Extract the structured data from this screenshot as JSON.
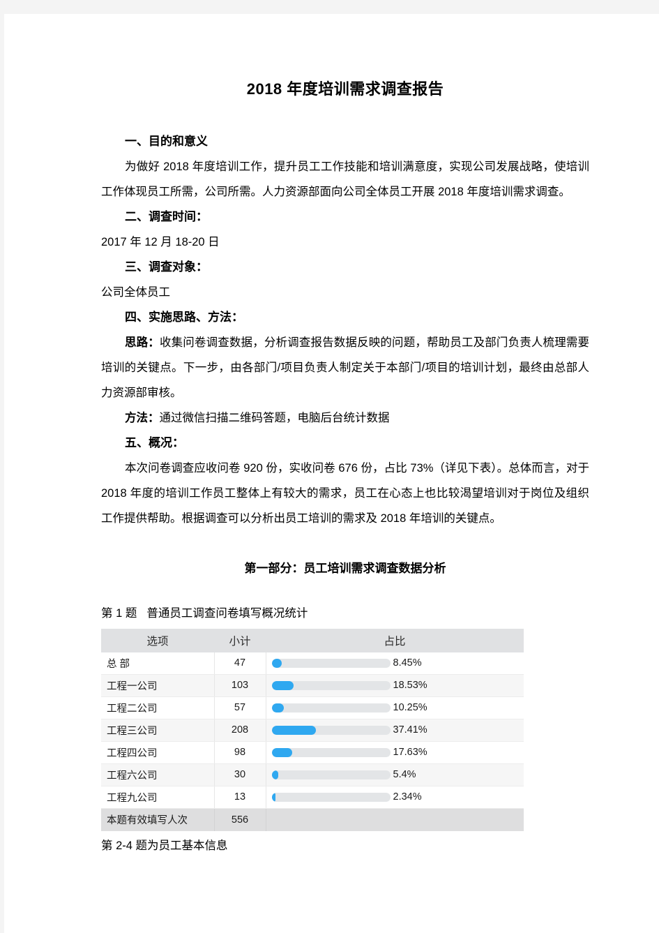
{
  "document": {
    "title": "2018 年度培训需求调查报告",
    "sections": [
      {
        "heading": "一、目的和意义"
      },
      {
        "heading": "二、调查时间："
      },
      {
        "heading": "三、调查对象："
      },
      {
        "heading": "四、实施思路、方法："
      },
      {
        "heading": "五、概况："
      }
    ],
    "purpose_paragraph": "为做好 2018 年度培训工作，提升员工工作技能和培训满意度，实现公司发展战略，使培训工作体现员工所需，公司所需。人力资源部面向公司全体员工开展 2018 年度培训需求调查。",
    "survey_time": "2017 年 12 月 18-20 日",
    "survey_target": "公司全体员工",
    "approach_label": "思路：",
    "approach_text": "收集问卷调查数据，分析调查报告数据反映的问题，帮助员工及部门负责人梳理需要培训的关键点。下一步，由各部门/项目负责人制定关于本部门/项目的培训计划，最终由总部人力资源部审核。",
    "method_label": "方法：",
    "method_text": "通过微信扫描二维码答题，电脑后台统计数据",
    "overview_text": "本次问卷调查应收问卷 920 份，实收问卷 676 份，占比 73%（详见下表）。总体而言，对于 2018 年度的培训工作员工整体上有较大的需求，员工在心态上也比较渴望培训对于岗位及组织工作提供帮助。根据调查可以分析出员工培训的需求及 2018 年培训的关键点。",
    "part_title": "第一部分：员工培训需求调查数据分析",
    "question_number": "第 1 题",
    "question_title": "普通员工调查问卷填写概况统计",
    "after_table_note": "第 2-4 题为员工基本信息",
    "summary_numbers": {
      "expected_questionnaires": "920",
      "received_questionnaires": "676",
      "response_rate": "73%"
    }
  },
  "colors": {
    "bar_fill": "#2fa8f0",
    "bar_track": "#e3e5e7",
    "table_header_bg": "#e0e1e3",
    "table_footer_bg": "#dededf",
    "page_bg": "#f4f4f4"
  },
  "chart_data": {
    "type": "bar",
    "title": "第 1 题  普通员工调查问卷填写概况统计",
    "orientation": "horizontal",
    "columns": [
      "选项",
      "小计",
      "占比"
    ],
    "categories": [
      "总 部",
      "工程一公司",
      "工程二公司",
      "工程三公司",
      "工程四公司",
      "工程六公司",
      "工程九公司"
    ],
    "values": [
      47,
      103,
      57,
      208,
      98,
      30,
      13
    ],
    "percents": [
      8.45,
      18.53,
      10.25,
      37.41,
      17.63,
      5.4,
      2.34
    ],
    "percent_labels": [
      "8.45%",
      "18.53%",
      "10.25%",
      "37.41%",
      "17.63%",
      "5.4%",
      "2.34%"
    ],
    "xlabel": "",
    "ylabel": "",
    "xlim": [
      0,
      100
    ],
    "grid": false,
    "legend": "none",
    "footer_label": "本题有效填写人次",
    "footer_value": "556"
  },
  "table_rows": [
    {
      "option": "总 部",
      "count": "47",
      "percent_label": "8.45%",
      "percent": 8.45
    },
    {
      "option": "工程一公司",
      "count": "103",
      "percent_label": "18.53%",
      "percent": 18.53
    },
    {
      "option": "工程二公司",
      "count": "57",
      "percent_label": "10.25%",
      "percent": 10.25
    },
    {
      "option": "工程三公司",
      "count": "208",
      "percent_label": "37.41%",
      "percent": 37.41
    },
    {
      "option": "工程四公司",
      "count": "98",
      "percent_label": "17.63%",
      "percent": 17.63
    },
    {
      "option": "工程六公司",
      "count": "30",
      "percent_label": "5.4%",
      "percent": 5.4
    },
    {
      "option": "工程九公司",
      "count": "13",
      "percent_label": "2.34%",
      "percent": 2.34
    }
  ]
}
